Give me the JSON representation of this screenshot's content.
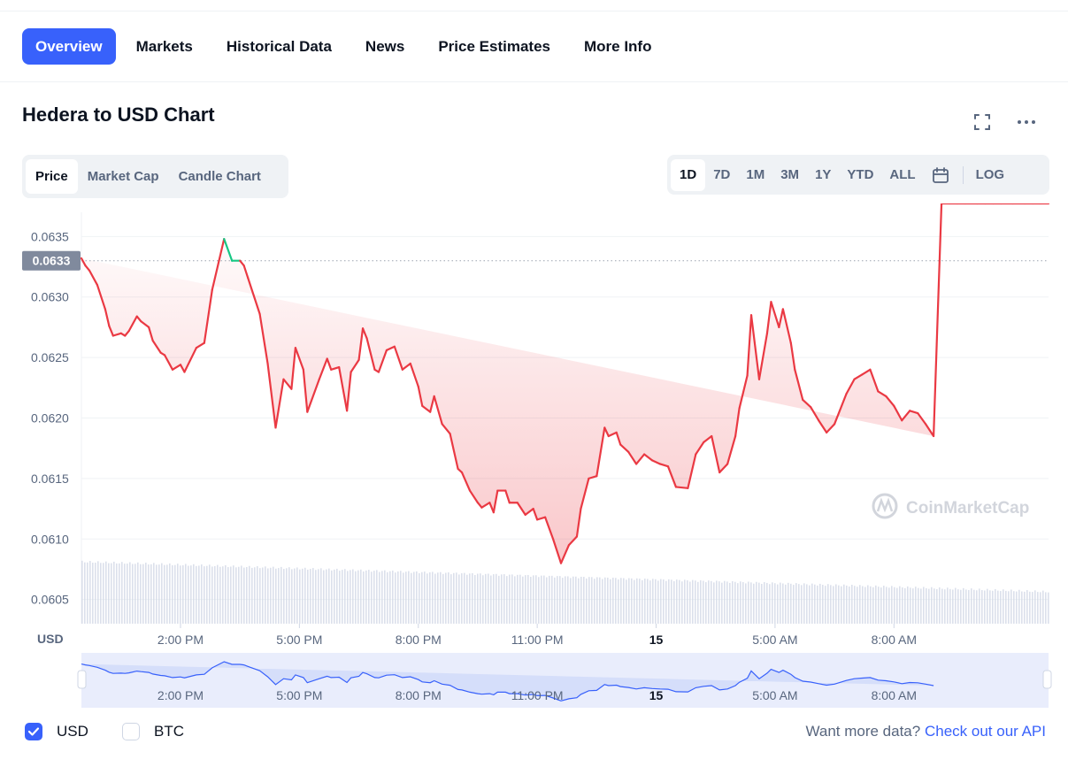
{
  "tabs": [
    {
      "label": "Overview",
      "active": true
    },
    {
      "label": "Markets"
    },
    {
      "label": "Historical Data"
    },
    {
      "label": "News"
    },
    {
      "label": "Price Estimates"
    },
    {
      "label": "More Info"
    }
  ],
  "chart_title": "Hedera to USD Chart",
  "icons": {
    "fullscreen": "fullscreen-icon",
    "more": "more-options-icon",
    "calendar": "calendar-icon"
  },
  "chart_type_tabs": [
    {
      "label": "Price",
      "active": true
    },
    {
      "label": "Market Cap"
    },
    {
      "label": "Candle Chart"
    }
  ],
  "range_tabs": [
    {
      "label": "1D",
      "active": true
    },
    {
      "label": "7D"
    },
    {
      "label": "1M"
    },
    {
      "label": "3M"
    },
    {
      "label": "1Y"
    },
    {
      "label": "YTD"
    },
    {
      "label": "ALL"
    }
  ],
  "log_label": "LOG",
  "watermark": "CoinMarketCap",
  "colors": {
    "accent": "#3861fb",
    "down": "#ea3943",
    "up": "#16c784",
    "text": "#0d1421",
    "muted": "#58667e"
  },
  "currency_toggles": [
    {
      "label": "USD",
      "checked": true
    },
    {
      "label": "BTC",
      "checked": false
    }
  ],
  "more_data": {
    "text": "Want more data?",
    "link": "Check out our API"
  },
  "chart_data": {
    "type": "area",
    "ylabel": "USD",
    "ylim": [
      0.0603,
      0.0637
    ],
    "yticks": [
      "0.0605",
      "0.0610",
      "0.0615",
      "0.0620",
      "0.0625",
      "0.0630",
      "0.0635"
    ],
    "current_price_label": "0.0633",
    "current_price": 0.0633,
    "xlim": [
      11.5,
      35.9
    ],
    "xticks": [
      {
        "label": "2:00 PM",
        "h": 14,
        "bold": false
      },
      {
        "label": "5:00 PM",
        "h": 17,
        "bold": false
      },
      {
        "label": "8:00 PM",
        "h": 20,
        "bold": false
      },
      {
        "label": "11:00 PM",
        "h": 23,
        "bold": false
      },
      {
        "label": "15",
        "h": 26,
        "bold": true
      },
      {
        "label": "5:00 AM",
        "h": 29,
        "bold": false
      },
      {
        "label": "8:00 AM",
        "h": 32,
        "bold": false
      }
    ],
    "x_hours": [
      11.5,
      11.6,
      11.7,
      11.9,
      12.1,
      12.2,
      12.3,
      12.5,
      12.6,
      12.7,
      12.9,
      13.0,
      13.2,
      13.3,
      13.5,
      13.6,
      13.8,
      14.0,
      14.1,
      14.4,
      14.6,
      14.8,
      15.1,
      15.3,
      15.5,
      15.6,
      15.7,
      16.0,
      16.2,
      16.4,
      16.6,
      16.8,
      16.9,
      17.1,
      17.2,
      17.5,
      17.7,
      17.8,
      18.0,
      18.2,
      18.3,
      18.5,
      18.6,
      18.7,
      18.9,
      19.0,
      19.2,
      19.4,
      19.6,
      19.8,
      20.0,
      20.1,
      20.3,
      20.4,
      20.6,
      20.8,
      21.0,
      21.1,
      21.3,
      21.5,
      21.6,
      21.8,
      21.9,
      22.0,
      22.2,
      22.3,
      22.5,
      22.7,
      22.9,
      23.0,
      23.2,
      23.4,
      23.6,
      23.8,
      24.0,
      24.1,
      24.3,
      24.5,
      24.7,
      24.8,
      25.0,
      25.1,
      25.3,
      25.5,
      25.7,
      25.9,
      26.1,
      26.3,
      26.5,
      26.8,
      27.0,
      27.2,
      27.4,
      27.6,
      27.8,
      28.0,
      28.1,
      28.3,
      28.4,
      28.6,
      28.8,
      28.9,
      29.1,
      29.2,
      29.4,
      29.5,
      29.7,
      29.9,
      30.1,
      30.3,
      30.5,
      30.8,
      31.0,
      31.2,
      31.4,
      31.6,
      31.8,
      32.0,
      32.2,
      32.4,
      32.6,
      32.8,
      33.0,
      33.2,
      33.4,
      33.6,
      33.8,
      34.1,
      34.3,
      34.5,
      34.7,
      35.0,
      35.3,
      35.5,
      35.7,
      35.9
    ],
    "prices": [
      0.06332,
      0.06326,
      0.06322,
      0.0631,
      0.0629,
      0.06276,
      0.06268,
      0.0627,
      0.06268,
      0.06272,
      0.06284,
      0.0628,
      0.06275,
      0.06264,
      0.06254,
      0.06252,
      0.0624,
      0.06244,
      0.06238,
      0.06258,
      0.06262,
      0.06306,
      0.06348,
      0.0633,
      0.0633,
      0.06326,
      0.06316,
      0.06286,
      0.06245,
      0.06192,
      0.06232,
      0.06224,
      0.06258,
      0.0624,
      0.06205,
      0.06232,
      0.06249,
      0.0624,
      0.06242,
      0.06206,
      0.06238,
      0.06248,
      0.06274,
      0.06266,
      0.0624,
      0.06238,
      0.06256,
      0.06259,
      0.0624,
      0.06245,
      0.06226,
      0.0621,
      0.06205,
      0.06218,
      0.06195,
      0.06187,
      0.06158,
      0.06155,
      0.0614,
      0.0613,
      0.06126,
      0.0613,
      0.06122,
      0.0614,
      0.0614,
      0.0613,
      0.0613,
      0.0612,
      0.06125,
      0.06116,
      0.06118,
      0.061,
      0.0608,
      0.06095,
      0.06102,
      0.06125,
      0.0615,
      0.06152,
      0.06192,
      0.06185,
      0.06188,
      0.06178,
      0.06172,
      0.06162,
      0.0617,
      0.06165,
      0.06162,
      0.0616,
      0.06143,
      0.06142,
      0.0617,
      0.0618,
      0.06185,
      0.06155,
      0.06162,
      0.06185,
      0.06208,
      0.06235,
      0.06285,
      0.06232,
      0.0627,
      0.06296,
      0.06275,
      0.0629,
      0.06262,
      0.0624,
      0.06215,
      0.06209,
      0.06198,
      0.06188,
      0.06195,
      0.0622,
      0.06232,
      0.06236,
      0.0624,
      0.06222,
      0.06218,
      0.0621,
      0.06198,
      0.06206,
      0.06204,
      0.06195,
      0.06185
    ]
  }
}
